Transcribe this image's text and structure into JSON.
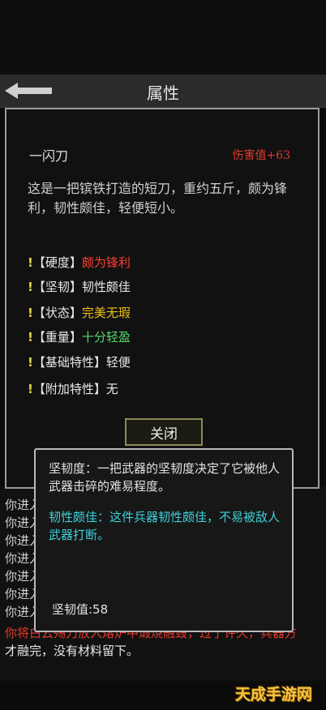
{
  "header": {
    "title": "属性"
  },
  "weapon": {
    "name": "一闪刀",
    "damage": "伤害值+63",
    "description": "这是一把镔铁打造的短刀，重约五斤，颇为锋利，韧性颇佳，轻便短小。"
  },
  "attributes": [
    {
      "bang": "!",
      "label": "【硬度】",
      "value": "颇为锋利",
      "color": "#ff3b30"
    },
    {
      "bang": "!",
      "label": "【坚韧】",
      "value": "韧性颇佳",
      "color": "#e8e8e8"
    },
    {
      "bang": "!",
      "label": "【状态】",
      "value": "完美无瑕",
      "color": "#f0c419"
    },
    {
      "bang": "!",
      "label": "【重量】",
      "value": "十分轻盈",
      "color": "#55d96a"
    },
    {
      "bang": "!",
      "label": "【基础特性】",
      "value": "轻便",
      "color": "#e8e8e8"
    },
    {
      "bang": "!",
      "label": "【附加特性】",
      "value": "无",
      "color": "#e8e8e8"
    }
  ],
  "close_label": "关闭",
  "tooltip": {
    "description": "坚韧度：一把武器的坚韧度决定了它被他人武器击碎的难易程度。",
    "quality": "韧性颇佳：这件兵器韧性颇佳，不易被敌人武器打断。",
    "value": "坚韧值:58"
  },
  "log": {
    "lines": [
      "你进入",
      "你进入",
      "你进入",
      "你进入",
      "你进入",
      "你进入",
      "你进入"
    ],
    "red_line": "你将白云殇刀放入熔炉中煅烧融毁，过了许久，兵器方",
    "last_line": "才融完，没有材料留下。"
  },
  "watermark": "天成手游网",
  "colors": {
    "accent_red": "#e23b2e",
    "tip_cyan": "#3fd0d8"
  }
}
